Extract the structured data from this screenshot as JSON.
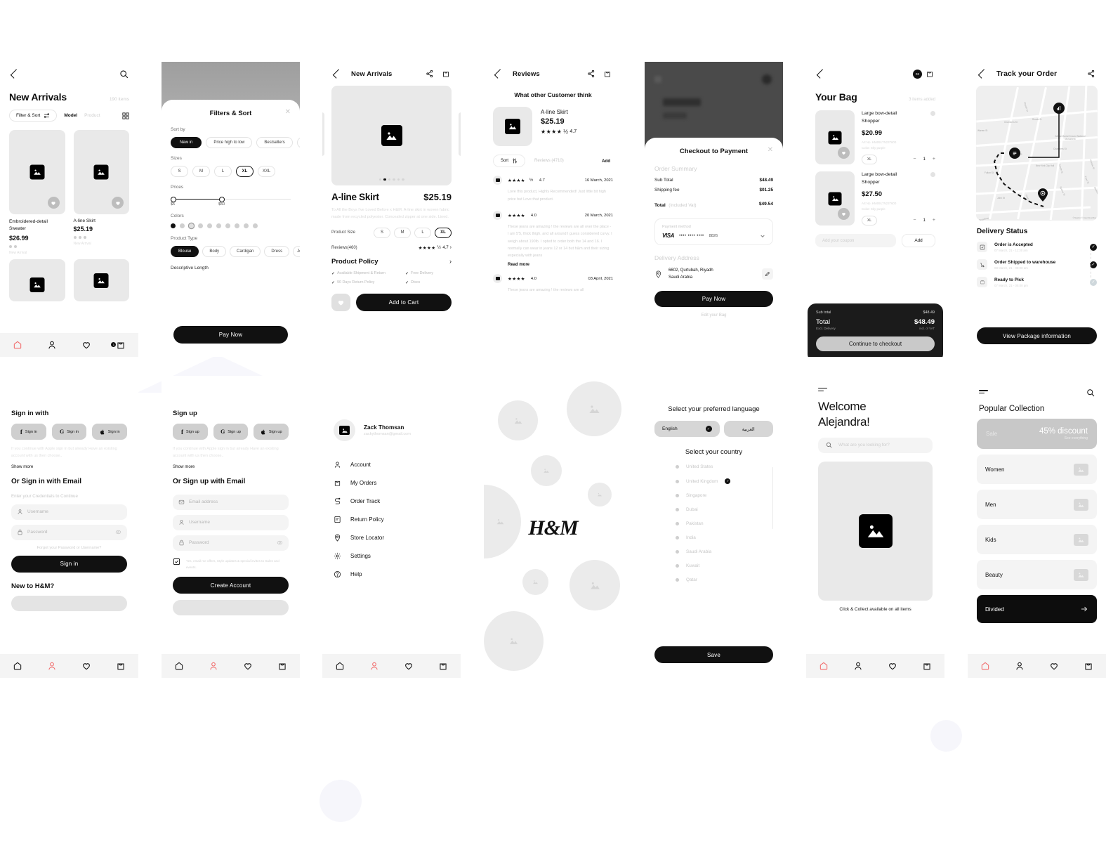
{
  "screens": {
    "new_arrivals": {
      "title": "New Arrivals",
      "items_count": "190 items",
      "filter_button": "Filter & Sort",
      "tab_model": "Model",
      "tab_product": "Product",
      "products": [
        {
          "name": "Embroidered-detail Sweater",
          "price": "$26.99",
          "tag": "New Arrival"
        },
        {
          "name": "A-line Skirt",
          "price": "$25.19",
          "tag": "New Arrival"
        }
      ]
    },
    "filters": {
      "title": "Filters & Sort",
      "sort_by_label": "Sort by",
      "sort_options": [
        "New in",
        "Price high to low",
        "Bestsellers",
        "Pr"
      ],
      "sizes_label": "Sizes",
      "sizes": [
        "S",
        "M",
        "L",
        "XL",
        "XXL"
      ],
      "size_selected": "XL",
      "prices_label": "Prices",
      "price_min": "$5",
      "price_max": "$50",
      "colors_label": "Colors",
      "product_type_label": "Product Type",
      "product_types": [
        "Blouse",
        "Body",
        "Cardigan",
        "Dress",
        "Jea"
      ],
      "descriptive_length_label": "Descriptive Length",
      "cta": "Pay Now"
    },
    "product": {
      "header_title": "New Arrivals",
      "name": "A-line Skirt",
      "price": "$25.19",
      "description": "To All the Boys I've Loved Before x H&M. A-line skirt in woven fabric made from recycled polyester. Concealed zipper at one side. Lined.",
      "size_label": "Product Size",
      "sizes": [
        "S",
        "M",
        "L",
        "XL"
      ],
      "size_selected": "XL",
      "reviews_label": "Reviews(460)",
      "rating": "4.7",
      "policy_title": "Product Policy",
      "policies": [
        "Available Shipment & Return",
        "Free Delivery",
        "90 Days Return Policy",
        "Discs"
      ],
      "cta": "Add to Cart"
    },
    "reviews": {
      "header_title": "Reviews",
      "heading": "What other Customer think",
      "product_name": "A-line Skirt",
      "product_price": "$25.19",
      "product_rating": "4.7",
      "sort_label": "Sort",
      "count_label": "Reviews (4710)",
      "add_label": "Add",
      "list": [
        {
          "rating": "4.7",
          "stars": 5,
          "date": "16 March, 2021",
          "text": "Love this product, Highly Recommended! Just little bit high price but Love that product."
        },
        {
          "rating": "4.0",
          "stars": 4,
          "date": "20 March, 2021",
          "text": "These jeans are amazing ! the reviews are all over the place - I am 5'5, thick thigh, and all around I guess considered curvy. I weigh about 190lb. I opted to order both the 14 and 16. I normally can wear in jeans 12 or 14 but h&m and their sizing especially with jeans",
          "more": "Read more"
        },
        {
          "rating": "4.0",
          "stars": 4,
          "date": "03 April, 2021",
          "text": "These jeans are amazing ! the reviews are all"
        }
      ]
    },
    "checkout": {
      "title": "Checkout to Payment",
      "summary_title": "Order Summary",
      "rows": [
        {
          "label": "Sub Total",
          "value": "$48.49"
        },
        {
          "label": "Shipping fee",
          "value": "$01.25"
        }
      ],
      "total_label": "Total",
      "total_note": "(Included Vat)",
      "total_value": "$49.54",
      "payment_label": "Payment method",
      "card_brand": "VISA",
      "card_mask": "•••• •••• ••••",
      "card_last4": "8826",
      "address_title": "Delivery Address",
      "address_line1": "6602, Qurtubah, Riyadh",
      "address_line2": "Saudi Arabia",
      "cta": "Pay Now",
      "secondary": "Edit your Bag"
    },
    "bag": {
      "title": "Your Bag",
      "count": "3 items added",
      "cart_badge": "03",
      "items": [
        {
          "name": "Large bow-detail Shopper",
          "price": "$20.99",
          "art_no": "Art No. HM0917N237600",
          "color": "Color: Sky purple",
          "size": "XL",
          "qty": "1"
        },
        {
          "name": "Large bow-detail Shopper",
          "price": "$27.50",
          "art_no": "Art No. HM0917N237600",
          "color": "Color: Sky purple",
          "size": "XL",
          "qty": "1"
        }
      ],
      "coupon_placeholder": "Add your coupon",
      "coupon_button": "Add",
      "sub_total_label": "Sub total",
      "sub_total_value": "$48.49",
      "total_label": "Total",
      "total_note": "Excl. Delivery",
      "total_value": "$48.49",
      "total_vat": "incl. of VAT",
      "cta": "Continue to checkout"
    },
    "track": {
      "title": "Track your Order",
      "status_title": "Delivery Status",
      "map_labels": [
        "Church St",
        "Chambers St",
        "Reade St",
        "Chambers St",
        "Park Pl",
        "Centre St",
        "Warren St",
        "Fulton St",
        "John St",
        "Gold St",
        "Pearl St",
        "Spruce St",
        "Beekman St",
        "Frankfort St",
        "New York City Hall",
        "African Burial Ground National Monument",
        "Broadway",
        "Nassau St"
      ],
      "map_credit": "© Mapbox © OpenStreetMap",
      "steps": [
        {
          "title": "Order is Accepted",
          "when": "07 March, 21 - 11:30 am",
          "done": true
        },
        {
          "title": "Order Shipped to warehouse",
          "when": "08 March, 21 - 09:00 am",
          "done": true
        },
        {
          "title": "Ready to Pick",
          "when": "07 March, 21 - 05:00 pm",
          "done": false
        }
      ],
      "cta": "View Package information"
    },
    "signin": {
      "heading": "Sign in with",
      "social": [
        {
          "icon": "facebook-icon",
          "label": "Sign in"
        },
        {
          "icon": "google-icon",
          "label": "Sign in"
        },
        {
          "icon": "apple-icon",
          "label": "Sign in"
        }
      ],
      "note": "If you continue with Apple sign in but already Have an existing account with us then choose..",
      "show_more": "Show more",
      "email_heading": "Or Sign in with Email",
      "credentials_note": "Enter your Credentials to Continue",
      "username_placeholder": "Username",
      "password_placeholder": "Password",
      "forgot": "Forgot your Password or Username?",
      "cta": "Sign in",
      "new_heading": "New to H&M?"
    },
    "signup": {
      "heading": "Sign up",
      "social": [
        {
          "icon": "facebook-icon",
          "label": "Sign up"
        },
        {
          "icon": "google-icon",
          "label": "Sign up"
        },
        {
          "icon": "apple-icon",
          "label": "Sign up"
        }
      ],
      "note": "If you continue with Apple sign in but already Have an existing account with us then choose..",
      "show_more": "Show more",
      "email_heading": "Or Sign up with Email",
      "email_placeholder": "Email address",
      "username_placeholder": "Username",
      "password_placeholder": "Password",
      "consent": "Yes, email me offers, Style updates & special invites to Sales and events.",
      "cta": "Create Account"
    },
    "account": {
      "user_name": "Zack Thomsan",
      "user_email": "zackythomsan@gmail.com",
      "menu": [
        {
          "icon": "user-icon",
          "label": "Account"
        },
        {
          "icon": "bag-icon",
          "label": "My Orders"
        },
        {
          "icon": "track-icon",
          "label": "Order Track"
        },
        {
          "icon": "document-icon",
          "label": "Return Policy"
        },
        {
          "icon": "pin-icon",
          "label": "Store Locator"
        },
        {
          "icon": "gear-icon",
          "label": "Settings"
        },
        {
          "icon": "help-icon",
          "label": "Help"
        }
      ]
    },
    "splash": {
      "logo": "H&M"
    },
    "locale": {
      "language_heading": "Select your preferred language",
      "languages": [
        {
          "label": "English",
          "selected": true
        },
        {
          "label": "العربية",
          "selected": false
        }
      ],
      "country_heading": "Select your country",
      "countries": [
        {
          "label": "United States",
          "selected": false
        },
        {
          "label": "United Kingdom",
          "selected": true
        },
        {
          "label": "Singapore",
          "selected": false
        },
        {
          "label": "Dubai",
          "selected": false
        },
        {
          "label": "Pakistan",
          "selected": false
        },
        {
          "label": "India",
          "selected": false
        },
        {
          "label": "Saudi Arabia",
          "selected": false
        },
        {
          "label": "Kuwait",
          "selected": false
        },
        {
          "label": "Qatar",
          "selected": false
        }
      ],
      "cta": "Save"
    },
    "welcome": {
      "greeting_line1": "Welcome",
      "greeting_line2": "Alejandra!",
      "search_placeholder": "What are you looking for?",
      "caption": "Click & Collect available on all items"
    },
    "collection": {
      "title": "Popular Collection",
      "promo": {
        "tag": "Sale",
        "headline": "45% discount",
        "sub": "See everything"
      },
      "categories": [
        "Women",
        "Men",
        "Kids",
        "Beauty"
      ],
      "featured": "Divided"
    }
  },
  "colors": {
    "accent": "#F16A6A",
    "dark": "#111111",
    "placeholder_gray": "#e9e9e9",
    "surface_gray": "#f4f4f4"
  }
}
